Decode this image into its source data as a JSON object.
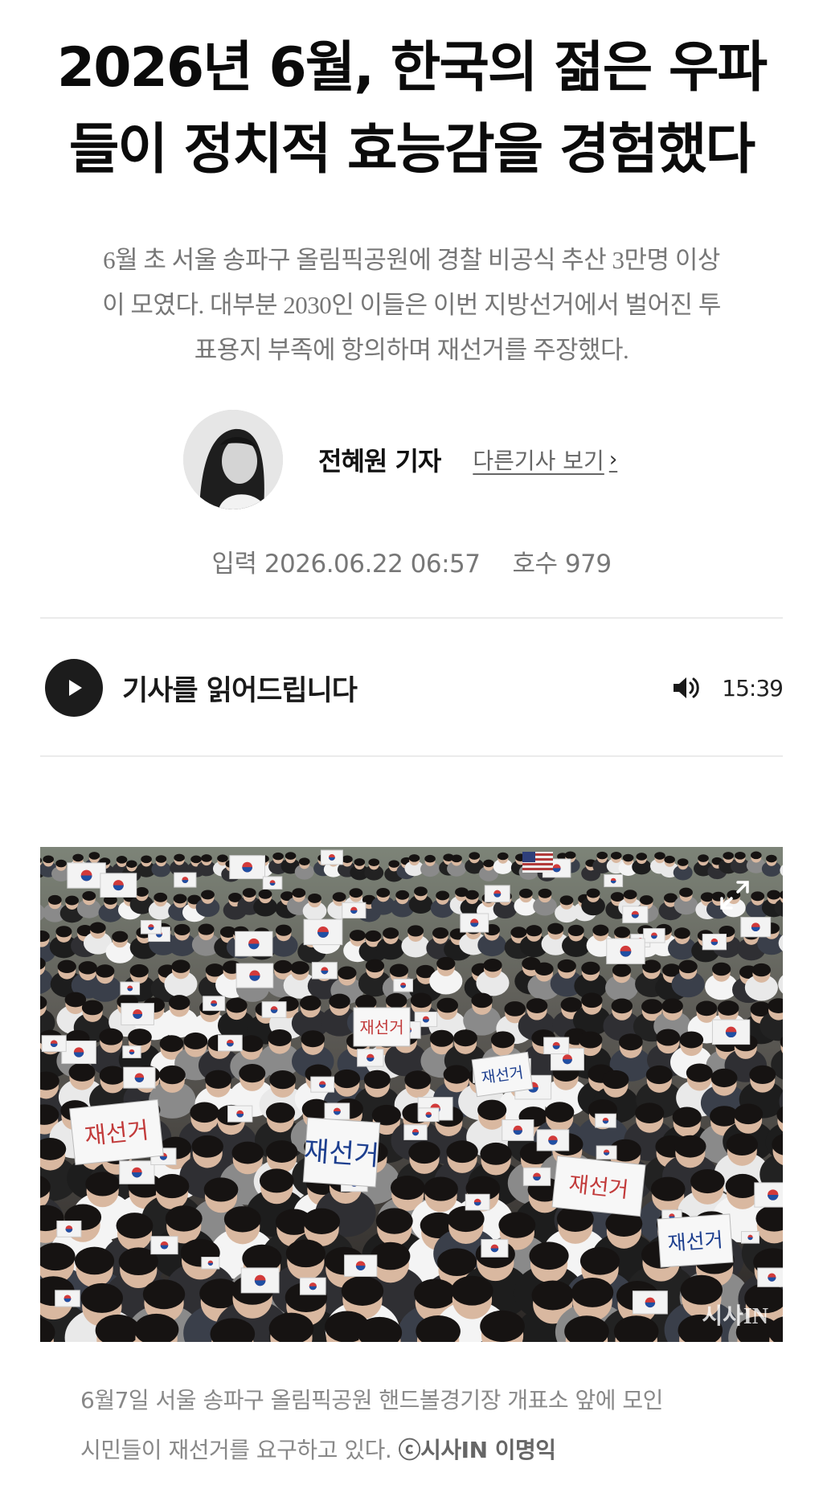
{
  "article": {
    "headline_line1": "2026년 6월, 한국의 젊은 우파",
    "headline_line2": "들이 정치적 효능감을 경험했다",
    "subhead_line1": "6월 초 서울 송파구 올림픽공원에 경찰 비공식 추산 3만명 이상",
    "subhead_line2": "이 모였다. 대부분 2030인 이들은 이번 지방선거에서 벌어진 투",
    "subhead_line3": "표용지 부족에 항의하며 재선거를 주장했다."
  },
  "byline": {
    "reporter": "전혜원 기자",
    "more_articles": "다른기사 보기"
  },
  "meta": {
    "published": "입력 2026.06.22 06:57",
    "issue": "호수 979"
  },
  "audio": {
    "label": "기사를 읽어드립니다",
    "duration": "15:39"
  },
  "photo": {
    "watermark": "시사IN",
    "caption_line1": "6월7일 서울 송파구 올림픽공원 핸드볼경기장 개표소 앞에 모인",
    "caption_line2": "시민들이 재선거를 요구하고 있다.",
    "credit": "ⓒ시사IN 이명익",
    "signs": [
      "재선거",
      "재선거",
      "재선거",
      "재선거",
      "재선거",
      "재선거"
    ]
  },
  "icons": {
    "play": "play-icon",
    "volume": "volume-icon",
    "expand": "expand-icon",
    "chevron": "chevron-right-icon"
  },
  "colors": {
    "text": "#111111",
    "muted": "#777777",
    "divider": "#ebebeb",
    "player": "#1c1c1c"
  }
}
